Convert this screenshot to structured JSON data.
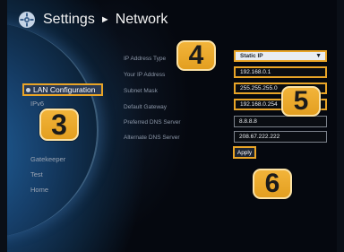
{
  "header": {
    "title": "Settings",
    "separator": "►",
    "section": "Network",
    "icon": "gear-icon"
  },
  "sidebar": {
    "items": [
      {
        "label": "LAN Configuration",
        "selected": true
      },
      {
        "label": "IPv6"
      },
      {
        "label": "Gatekeeper"
      },
      {
        "label": "Test"
      },
      {
        "label": "Home"
      }
    ]
  },
  "form": {
    "ip_type_label": "IP Address Type",
    "ip_type_value": "Static IP",
    "ip_address_label": "Your IP Address",
    "ip_address_value": "192.168.0.1",
    "subnet_label": "Subnet Mask",
    "subnet_value": "255.255.255.0",
    "gateway_label": "Default Gateway",
    "gateway_value": "192.168.0.254",
    "dns1_label": "Preferred DNS Server",
    "dns1_value": "8.8.8.8",
    "dns2_label": "Alternate DNS Server",
    "dns2_value": "208.67.222.222",
    "apply_label": "Apply"
  },
  "callouts": [
    "3",
    "4",
    "5",
    "6"
  ],
  "colors": {
    "highlight": "#e8a427",
    "background": "#05080f",
    "glow": "#1f5d96"
  }
}
